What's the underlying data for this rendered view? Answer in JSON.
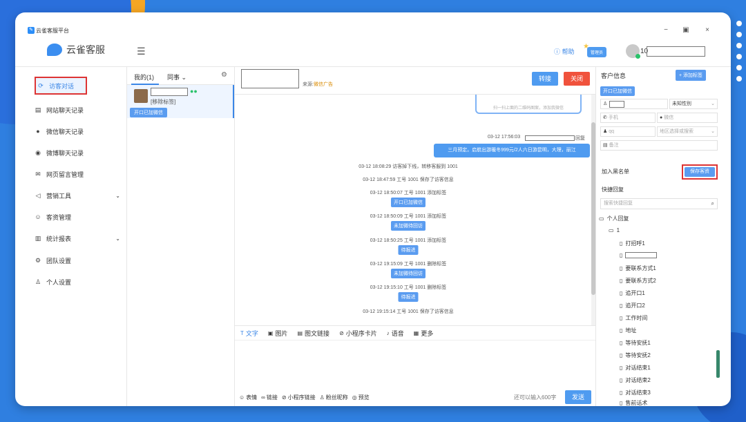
{
  "app": {
    "title": "云雀客服平台",
    "brand": "云雀客服"
  },
  "window": {
    "minimize": "−",
    "maximize": "▣",
    "close": "×"
  },
  "header": {
    "help": "帮助",
    "admin_badge": "管理员",
    "user_prefix": "10"
  },
  "sidebar": {
    "items": [
      {
        "label": "访客对话",
        "icon": "chat-icon"
      },
      {
        "label": "网站聊天记录",
        "icon": "document-icon"
      },
      {
        "label": "微信聊天记录",
        "icon": "wechat-icon"
      },
      {
        "label": "微博聊天记录",
        "icon": "weibo-icon"
      },
      {
        "label": "网页留言管理",
        "icon": "mail-icon"
      },
      {
        "label": "营销工具",
        "icon": "megaphone-icon"
      },
      {
        "label": "客资管理",
        "icon": "users-icon"
      },
      {
        "label": "统计报表",
        "icon": "chart-icon"
      },
      {
        "label": "团队设置",
        "icon": "gear-icon"
      },
      {
        "label": "个人设置",
        "icon": "user-icon"
      }
    ]
  },
  "conv_list": {
    "tab_mine": "我的(1)",
    "tab_peer": "同事",
    "item": {
      "tag": "[移除标签]",
      "button": "开口已加微信"
    }
  },
  "chat": {
    "from_prefix": "来源:",
    "from_source": "微信广告",
    "transfer": "转接",
    "close": "关闭",
    "card_text": "扫一扫上面的二维码图案，添加我微信",
    "right_time": "03-12 17:56:03",
    "right_suffix": "回复",
    "right_msg": "三月预定。启航出游暖冬999元/2人六日游昆明，大理，丽江",
    "events": [
      {
        "text": "03-12 18:08:29 访客掉下线，转移客服到 1001",
        "pill": ""
      },
      {
        "text": "03-12 18:47:59 工号 1001 保存了访客信息",
        "pill": ""
      },
      {
        "text": "03-12 18:50:07 工号 1001 添加标签",
        "pill": "开口已加微信"
      },
      {
        "text": "03-12 18:50:09 工号 1001 添加标签",
        "pill": "未加微待回访"
      },
      {
        "text": "03-12 18:50:25 工号 1001 添加标签",
        "pill": "待报进"
      },
      {
        "text": "03-12 19:15:09 工号 1001 删除标签",
        "pill": "未加微待回访"
      },
      {
        "text": "03-12 19:15:10 工号 1001 删除标签",
        "pill": "待报进"
      },
      {
        "text": "03-12 19:15:14 工号 1001 保存了访客信息",
        "pill": ""
      }
    ],
    "toolbar": [
      {
        "label": "文字",
        "icon": "text-icon"
      },
      {
        "label": "图片",
        "icon": "image-icon"
      },
      {
        "label": "图文链接",
        "icon": "article-link-icon"
      },
      {
        "label": "小程序卡片",
        "icon": "miniprogram-icon"
      },
      {
        "label": "语音",
        "icon": "microphone-icon"
      },
      {
        "label": "更多",
        "icon": "more-icon"
      }
    ],
    "bottom_tools": [
      {
        "label": "表情",
        "icon": "smile-icon"
      },
      {
        "label": "链接",
        "icon": "link-icon"
      },
      {
        "label": "小程序链接",
        "icon": "miniprogram-link-icon"
      },
      {
        "label": "粉丝昵称",
        "icon": "fan-icon"
      },
      {
        "label": "预览",
        "icon": "eye-icon"
      }
    ],
    "remaining": "还可以输入600字",
    "send": "发送"
  },
  "customer": {
    "title": "客户信息",
    "add_tag": "+ 添加标签",
    "wx_button": "开口已加微信",
    "gender_value": "未知性别",
    "phone_placeholder": "手机",
    "wechat_placeholder": "微信",
    "qq_placeholder": "qq",
    "region_placeholder": "地区选择或搜索",
    "note_placeholder": "备注",
    "blacklist": "加入黑名单",
    "save": "保存客资"
  },
  "quick_reply": {
    "title": "快捷回复",
    "search_placeholder": "搜索快捷回复",
    "folder": "个人回复",
    "subfolder": "1",
    "items": [
      "打招呼1",
      "",
      "要联系方式1",
      "要联系方式2",
      "追开口1",
      "追开口2",
      "工作时间",
      "地址",
      "等待安抚1",
      "等待安抚2",
      "对话结束1",
      "对话结束2",
      "对话结束3",
      "售前话术"
    ]
  }
}
